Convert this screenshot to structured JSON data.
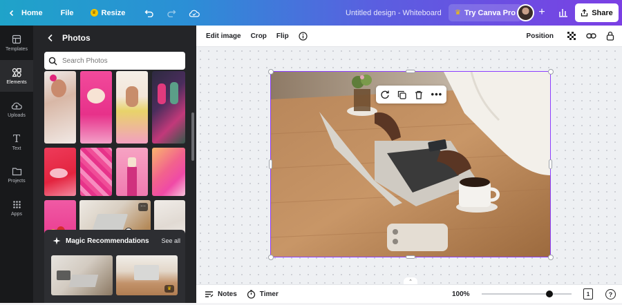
{
  "topbar": {
    "home_label": "Home",
    "file_label": "File",
    "resize_label": "Resize",
    "doc_title": "Untitled design - Whiteboard",
    "try_pro_label": "Try Canva Pro",
    "share_label": "Share",
    "gradient": [
      "#1fa3c9",
      "#7b3fe4"
    ]
  },
  "sidebar": {
    "items": [
      {
        "label": "Templates",
        "icon": "templates-icon"
      },
      {
        "label": "Elements",
        "icon": "elements-icon"
      },
      {
        "label": "Uploads",
        "icon": "uploads-icon"
      },
      {
        "label": "Text",
        "icon": "text-icon"
      },
      {
        "label": "Projects",
        "icon": "projects-icon"
      },
      {
        "label": "Apps",
        "icon": "apps-icon"
      }
    ],
    "active": "Elements"
  },
  "panel": {
    "title": "Photos",
    "search_placeholder": "Search Photos",
    "magic_title": "Magic Recommendations",
    "see_all_label": "See all"
  },
  "toolbar": {
    "edit_image": "Edit image",
    "crop": "Crop",
    "flip": "Flip",
    "position": "Position"
  },
  "bottombar": {
    "notes_label": "Notes",
    "timer_label": "Timer",
    "zoom_label": "100%",
    "page_number": "1"
  },
  "colors": {
    "accent": "#8b3dff",
    "panel_bg": "#242528",
    "sidebar_bg": "#18191b"
  }
}
